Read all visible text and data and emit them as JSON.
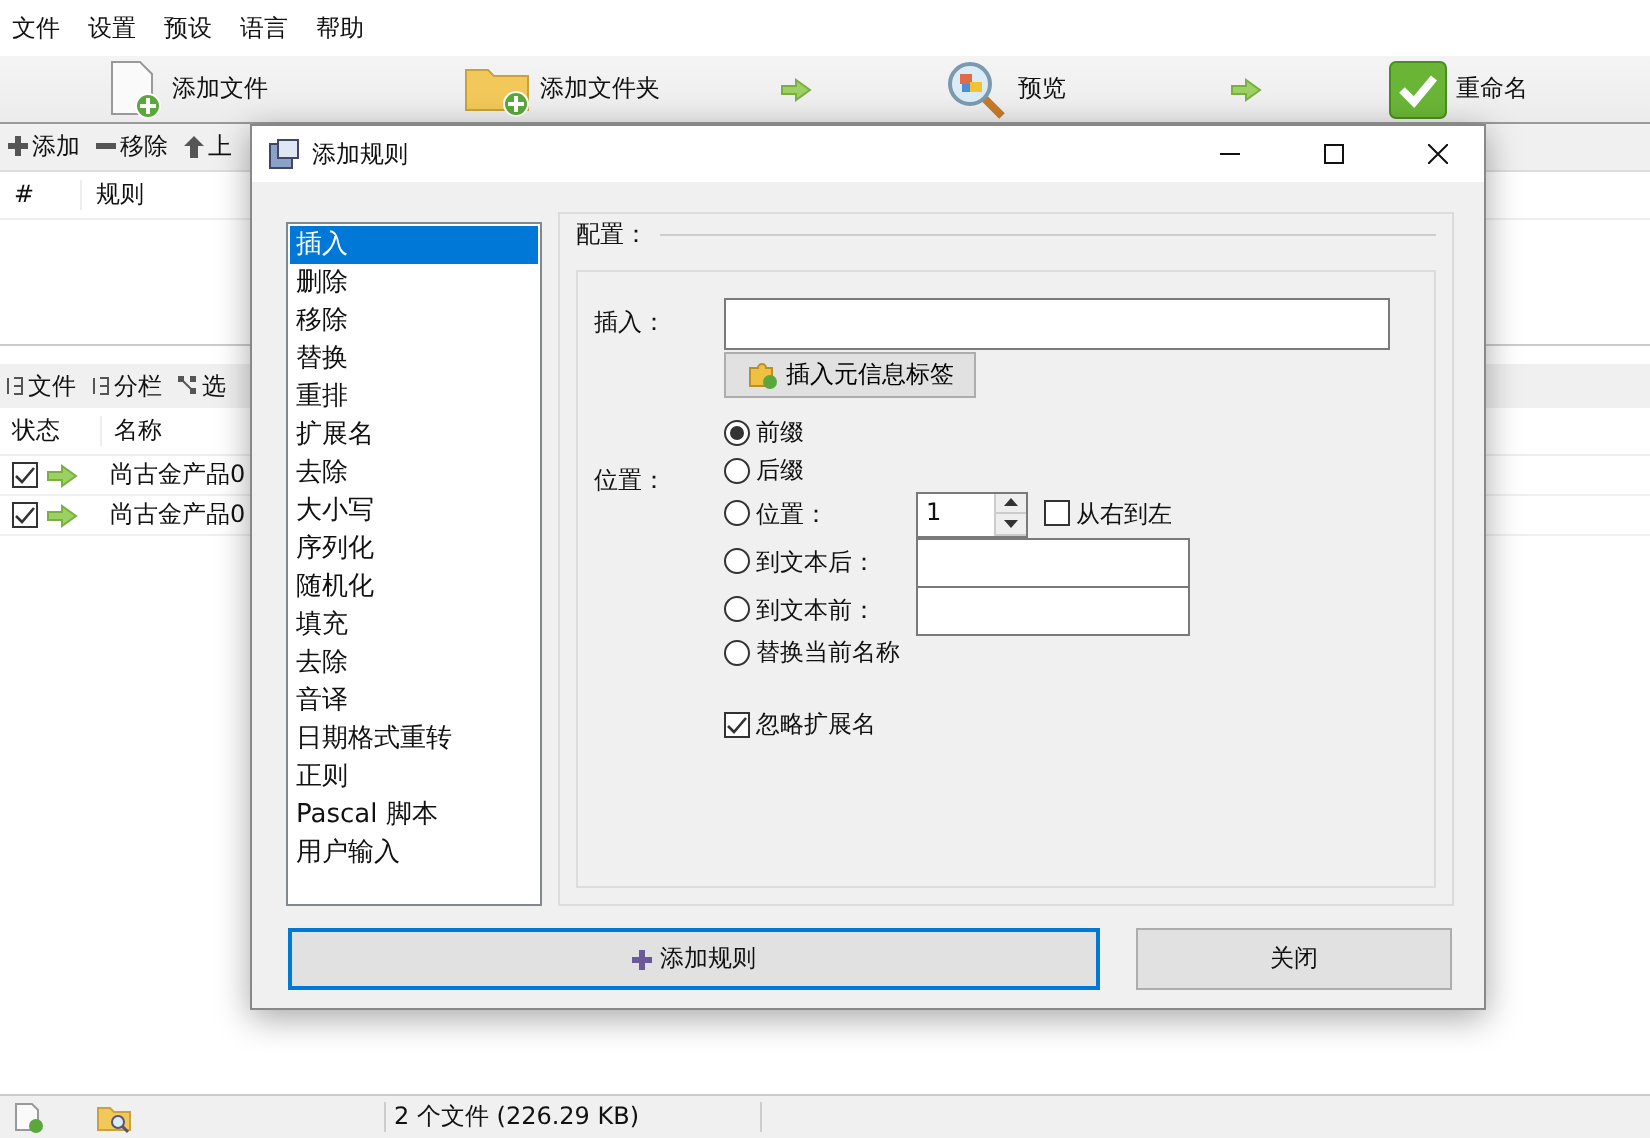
{
  "menu": [
    "文件",
    "设置",
    "预设",
    "语言",
    "帮助"
  ],
  "toolbar": [
    {
      "kind": "add-file",
      "label": "添加文件"
    },
    {
      "kind": "add-folder",
      "label": "添加文件夹"
    },
    {
      "kind": "arrow"
    },
    {
      "kind": "preview",
      "label": "预览"
    },
    {
      "kind": "arrow"
    },
    {
      "kind": "rename",
      "label": "重命名"
    }
  ],
  "rules_toolbar": [
    {
      "kind": "plus",
      "label": "添加"
    },
    {
      "kind": "minus",
      "label": "移除"
    },
    {
      "kind": "up",
      "label": "上"
    }
  ],
  "rules_table": {
    "columns": [
      "#",
      "规则"
    ]
  },
  "files_toolbar": [
    {
      "kind": "columns",
      "label": "文件"
    },
    {
      "kind": "columns",
      "label": "分栏"
    },
    {
      "kind": "options",
      "label": "选"
    }
  ],
  "files_table": {
    "columns": [
      "状态",
      "名称"
    ],
    "rows": [
      {
        "checked": true,
        "name": "尚古金产品0"
      },
      {
        "checked": true,
        "name": "尚古金产品0"
      }
    ]
  },
  "status_bar": {
    "text": "2 个文件 (226.29 KB)"
  },
  "dialog": {
    "title": "添加规则",
    "rules": [
      {
        "label": "插入",
        "selected": true
      },
      {
        "label": "删除",
        "selected": false
      },
      {
        "label": "移除",
        "selected": false
      },
      {
        "label": "替换",
        "selected": false
      },
      {
        "label": "重排",
        "selected": false
      },
      {
        "label": "扩展名",
        "selected": false
      },
      {
        "label": "去除",
        "selected": false
      },
      {
        "label": "大小写",
        "selected": false
      },
      {
        "label": "序列化",
        "selected": false
      },
      {
        "label": "随机化",
        "selected": false
      },
      {
        "label": "填充",
        "selected": false
      },
      {
        "label": "去除",
        "selected": false
      },
      {
        "label": "音译",
        "selected": false
      },
      {
        "label": "日期格式重转",
        "selected": false
      },
      {
        "label": "正则",
        "selected": false
      },
      {
        "label": "Pascal 脚本",
        "selected": false
      },
      {
        "label": "用户输入",
        "selected": false
      }
    ],
    "config_label": "配置：",
    "insert_label": "插入：",
    "meta_button": "插入元信息标签",
    "position_label": "位置：",
    "positions": [
      {
        "kind": "plain",
        "label": "前缀",
        "selected": true
      },
      {
        "kind": "plain",
        "label": "后缀",
        "selected": false
      },
      {
        "kind": "number",
        "label": "位置：",
        "selected": false,
        "value": "1"
      },
      {
        "kind": "text",
        "label": "到文本后：",
        "selected": false
      },
      {
        "kind": "text",
        "label": "到文本前：",
        "selected": false
      },
      {
        "kind": "plain",
        "label": "替换当前名称",
        "selected": false
      }
    ],
    "right_to_left": {
      "label": "从右到左",
      "checked": false
    },
    "ignore_extension": {
      "label": "忽略扩展名",
      "checked": true
    },
    "buttons": [
      {
        "kind": "primary",
        "label": "添加规则"
      },
      {
        "kind": "secondary",
        "label": "关闭"
      }
    ]
  }
}
